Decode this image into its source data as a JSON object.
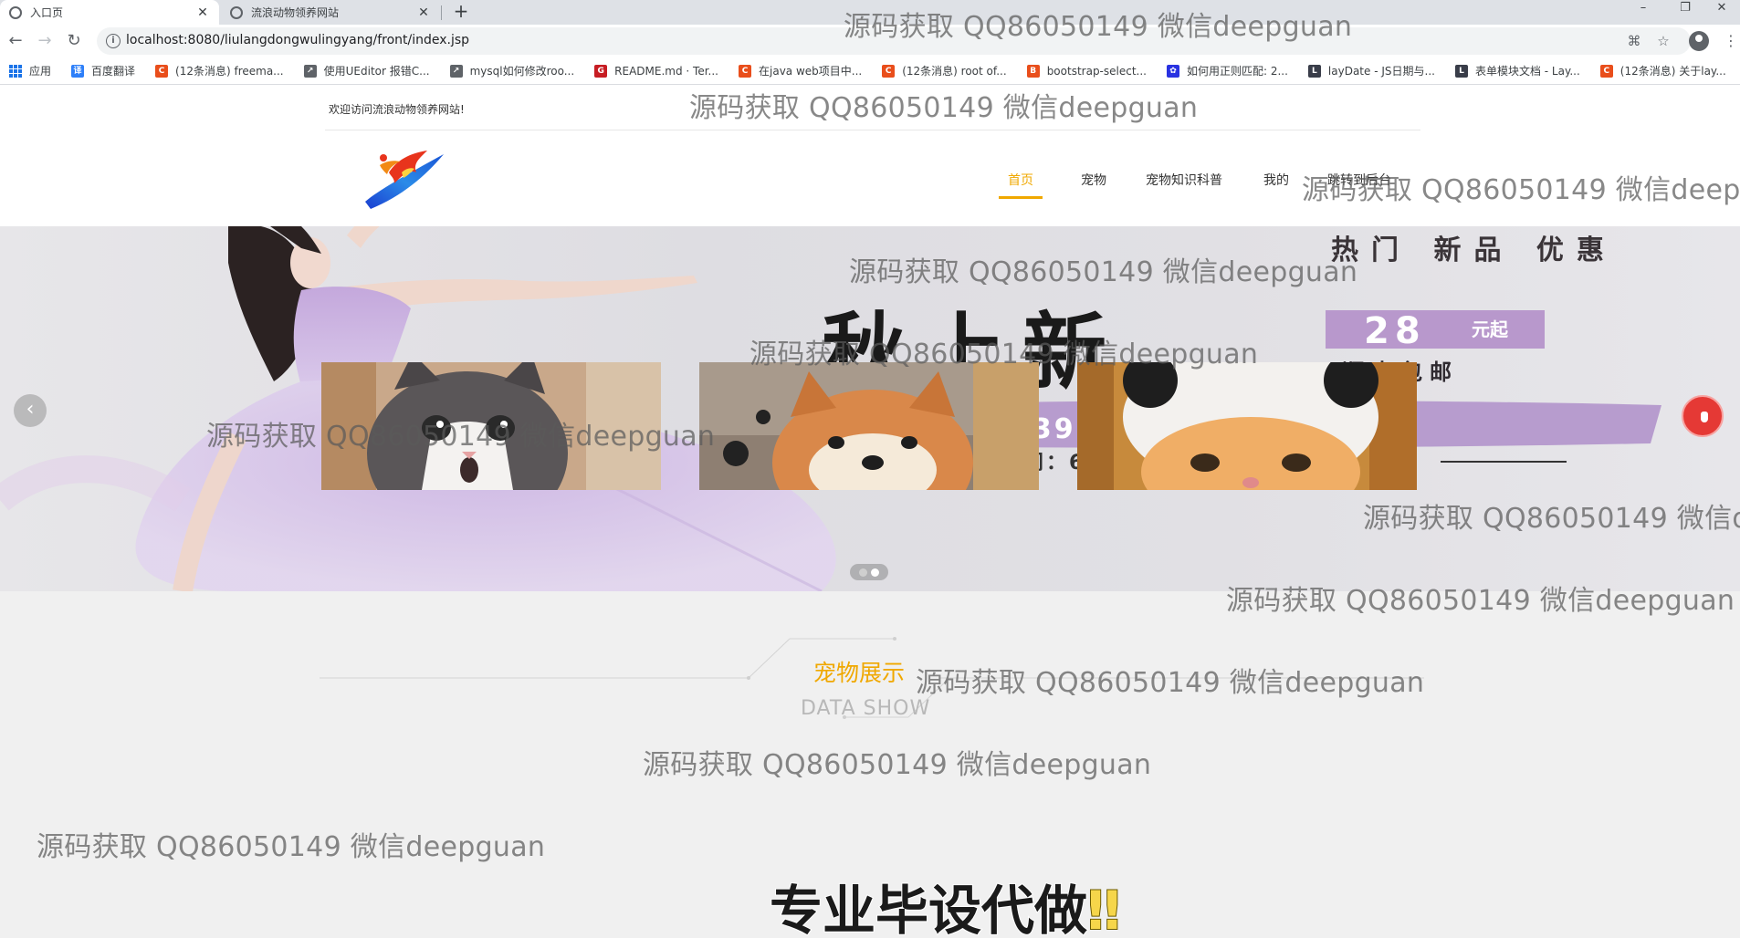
{
  "browser": {
    "tabs": [
      {
        "title": "入口页",
        "active": true
      },
      {
        "title": "流浪动物领养网站",
        "active": false
      }
    ],
    "url": "localhost:8080/liulangdongwulingyang/front/index.jsp",
    "bookmarks": [
      {
        "label": "应用",
        "icon": "apps-grid-icon",
        "color": "#1a73e8"
      },
      {
        "label": "百度翻译",
        "icon": "translate-icon",
        "color": "#2d7ff9"
      },
      {
        "label": "(12条消息) freema...",
        "icon": "csdn-icon",
        "color": "#e94e1b"
      },
      {
        "label": "使用UEditor 报错C...",
        "icon": "link-icon",
        "color": "#5f6368"
      },
      {
        "label": "mysql如何修改roo...",
        "icon": "link-icon",
        "color": "#5f6368"
      },
      {
        "label": "README.md · Ter...",
        "icon": "gitee-icon",
        "color": "#c71d23"
      },
      {
        "label": "在java web项目中...",
        "icon": "csdn-icon",
        "color": "#e94e1b"
      },
      {
        "label": "(12条消息) root of...",
        "icon": "csdn-icon",
        "color": "#e94e1b"
      },
      {
        "label": "bootstrap-select...",
        "icon": "bootstrap-icon",
        "color": "#e94e1b"
      },
      {
        "label": "如何用正则匹配: 2...",
        "icon": "paw-icon",
        "color": "#2932e1"
      },
      {
        "label": "layDate - JS日期与...",
        "icon": "layui-icon",
        "color": "#393d49"
      },
      {
        "label": "表单模块文档 - Lay...",
        "icon": "layui-icon",
        "color": "#393d49"
      },
      {
        "label": "(12条消息) 关于lay...",
        "icon": "csdn-icon",
        "color": "#e94e1b"
      }
    ]
  },
  "site": {
    "welcome": "欢迎访问流浪动物领养网站!",
    "nav": [
      {
        "label": "首页",
        "active": true
      },
      {
        "label": "宠物",
        "active": false
      },
      {
        "label": "宠物知识科普",
        "active": false
      },
      {
        "label": "我的",
        "active": false
      },
      {
        "label": "跳转到后台",
        "active": false
      }
    ],
    "banner": {
      "headline": "秋上新",
      "price": "28",
      "price_unit": "元起",
      "shipping": "顺丰包邮",
      "deals": "满299减30  399减50  699减100",
      "activity": "活动时间：6月28日-7月1日",
      "top_right": "热门 新品 优惠",
      "slides": 2,
      "current_slide": 1
    },
    "section": {
      "title": "宠物展示",
      "subtitle": "DATA SHOW"
    },
    "pets": [
      {
        "name": "cat-photo"
      },
      {
        "name": "shiba-photo"
      },
      {
        "name": "panda-hat-cat-photo"
      }
    ]
  },
  "overlays": {
    "watermark": "源码获取 QQ86050149 微信deepguan",
    "promo": "专业毕设代做",
    "promo_emoji": "‼"
  },
  "colors": {
    "accent": "#f0a800",
    "arrow_next": "#e53935"
  }
}
